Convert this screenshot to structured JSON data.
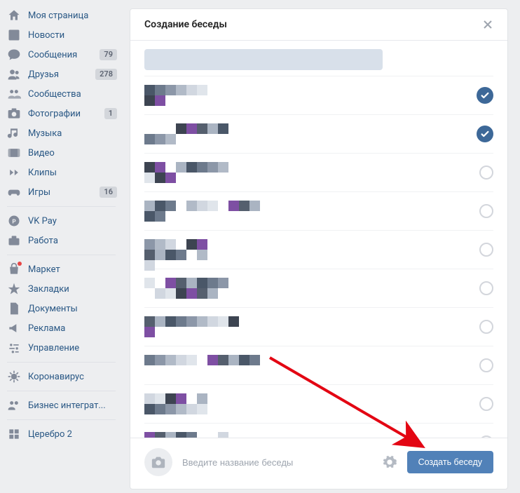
{
  "sidebar": {
    "items": [
      {
        "icon": "home",
        "label": "Моя страница"
      },
      {
        "icon": "news",
        "label": "Новости"
      },
      {
        "icon": "messages",
        "label": "Сообщения",
        "badge": "79"
      },
      {
        "icon": "friends",
        "label": "Друзья",
        "badge": "278"
      },
      {
        "icon": "communities",
        "label": "Сообщества"
      },
      {
        "icon": "photos",
        "label": "Фотографии",
        "badge": "1"
      },
      {
        "icon": "music",
        "label": "Музыка"
      },
      {
        "icon": "video",
        "label": "Видео"
      },
      {
        "icon": "clips",
        "label": "Клипы"
      },
      {
        "icon": "games",
        "label": "Игры",
        "badge": "16"
      }
    ],
    "items2": [
      {
        "icon": "vkpay",
        "label": "VK Pay"
      },
      {
        "icon": "work",
        "label": "Работа"
      }
    ],
    "items3": [
      {
        "icon": "market",
        "label": "Маркет",
        "red": true
      },
      {
        "icon": "bookmarks",
        "label": "Закладки"
      },
      {
        "icon": "docs",
        "label": "Документы"
      },
      {
        "icon": "ads",
        "label": "Реклама"
      },
      {
        "icon": "manage",
        "label": "Управление"
      }
    ],
    "items4": [
      {
        "icon": "covid",
        "label": "Коронавирус"
      }
    ],
    "items5": [
      {
        "icon": "biz",
        "label": "Бизнес интеграт..."
      }
    ],
    "items6": [
      {
        "icon": "cerebro",
        "label": "Церебро 2"
      }
    ]
  },
  "dialog": {
    "title": "Создание беседы",
    "contacts": [
      {
        "checked": true
      },
      {
        "checked": true
      },
      {
        "checked": false
      },
      {
        "checked": false
      },
      {
        "checked": false
      },
      {
        "checked": false
      },
      {
        "checked": false
      },
      {
        "checked": false
      },
      {
        "checked": false
      },
      {
        "checked": false
      }
    ],
    "input_placeholder": "Введите название беседы",
    "create_label": "Создать беседу"
  }
}
